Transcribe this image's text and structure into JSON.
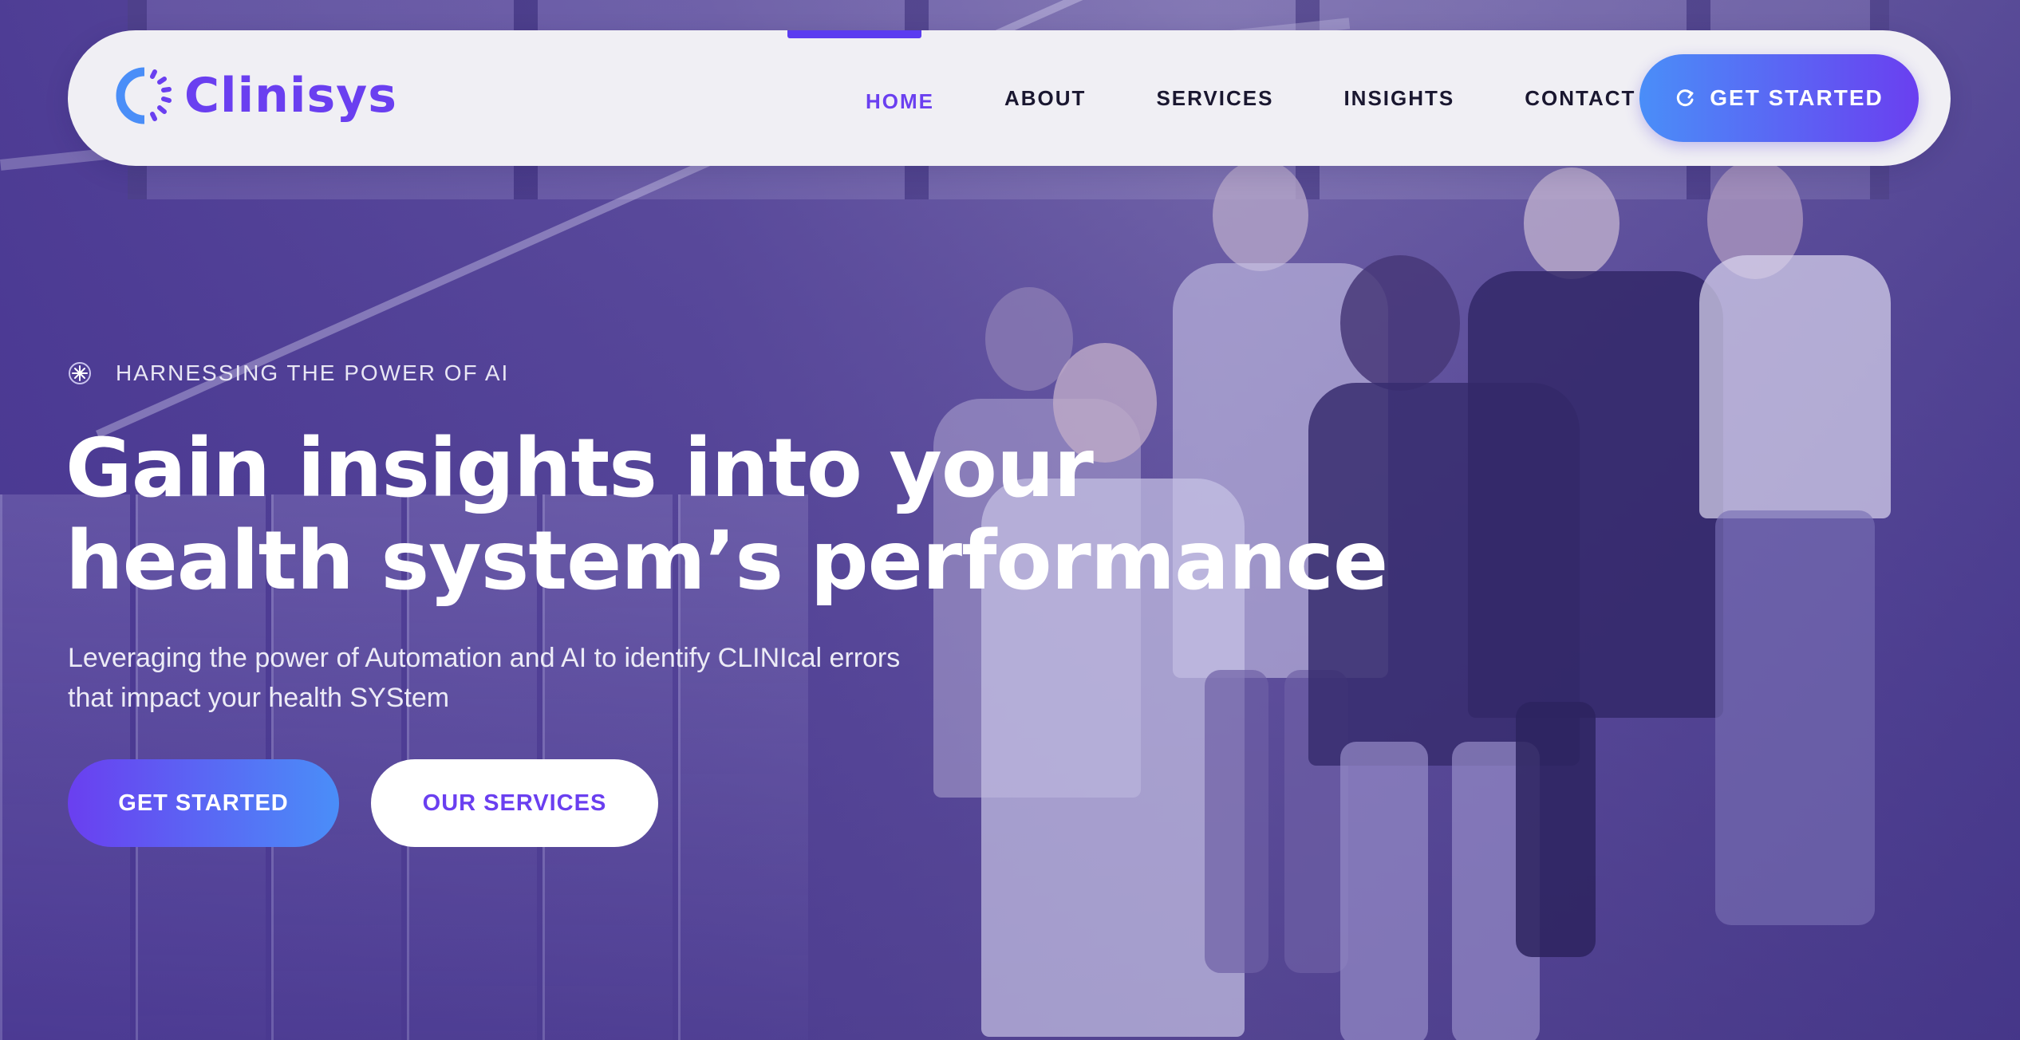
{
  "brand": {
    "name": "Clinisys",
    "logo_icon": "spinner-ring-icon",
    "colors": {
      "primary": "#6a3ff0",
      "accent_blue": "#4a8ef8",
      "nav_bg": "#f0eff4",
      "overlay": "#4a3b8c",
      "text_dark": "#1a1730"
    }
  },
  "nav": {
    "items": [
      {
        "label": "HOME",
        "active": true
      },
      {
        "label": "ABOUT",
        "active": false
      },
      {
        "label": "SERVICES",
        "active": false
      },
      {
        "label": "INSIGHTS",
        "active": false
      },
      {
        "label": "CONTACT",
        "active": false
      }
    ],
    "cta": {
      "label": "GET STARTED",
      "icon": "refresh-icon"
    }
  },
  "hero": {
    "eyebrow": {
      "icon": "starburst-icon",
      "text": "HARNESSING THE POWER OF AI"
    },
    "headline": {
      "line1": "Gain insights into your",
      "line2": "health system’s performance"
    },
    "subhead": {
      "line1": "Leveraging the power of Automation and AI to identify CLINIcal errors",
      "line2": "that impact your health SYStem"
    },
    "buttons": {
      "primary": "GET STARTED",
      "secondary": "OUR SERVICES"
    }
  }
}
